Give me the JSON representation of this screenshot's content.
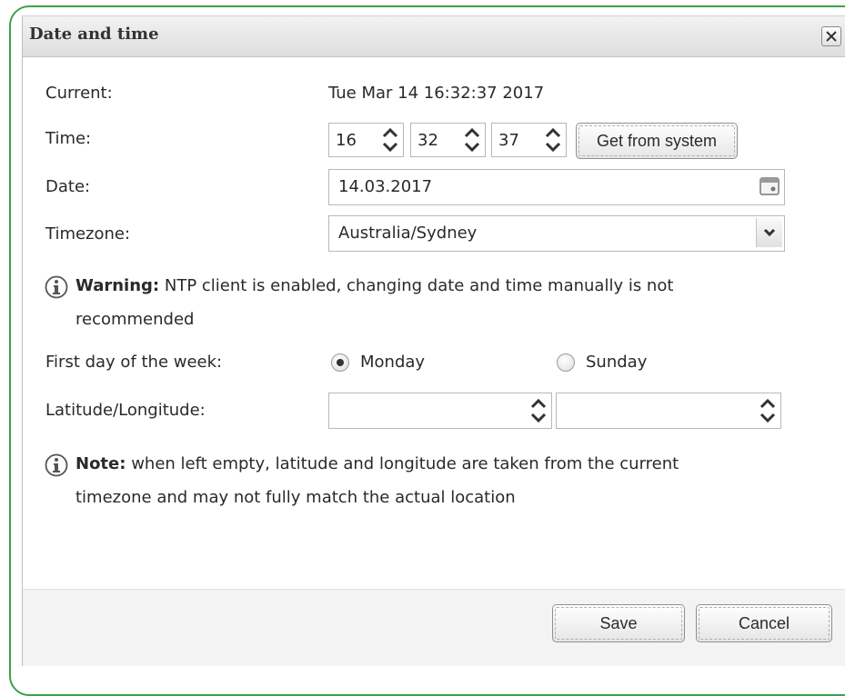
{
  "dialog": {
    "title": "Date and time",
    "close_icon": "close-icon"
  },
  "current": {
    "label": "Current:",
    "value": "Tue Mar 14 16:32:37 2017"
  },
  "time": {
    "label": "Time:",
    "hours": "16",
    "minutes": "32",
    "seconds": "37",
    "get_from_system_label": "Get from system"
  },
  "date": {
    "label": "Date:",
    "value": "14.03.2017",
    "icon": "calendar-icon"
  },
  "timezone": {
    "label": "Timezone:",
    "value": "Australia/Sydney",
    "icon": "chevron-down-icon"
  },
  "warning": {
    "bold": "Warning:",
    "text_line1": "NTP client is enabled, changing date and time manually is not",
    "text_line2": "recommended",
    "icon": "info-icon"
  },
  "first_day": {
    "label": "First day of the week:",
    "options": [
      "Monday",
      "Sunday"
    ],
    "selected": "Monday"
  },
  "latlon": {
    "label": "Latitude/Longitude:",
    "latitude": "",
    "longitude": ""
  },
  "note": {
    "bold": "Note:",
    "text_line1": "when left empty, latitude and longitude are taken from the current",
    "text_line2": "timezone and may not fully match the actual location",
    "icon": "info-icon"
  },
  "footer": {
    "save_label": "Save",
    "cancel_label": "Cancel"
  },
  "colors": {
    "frame_border": "#3aa34a"
  }
}
